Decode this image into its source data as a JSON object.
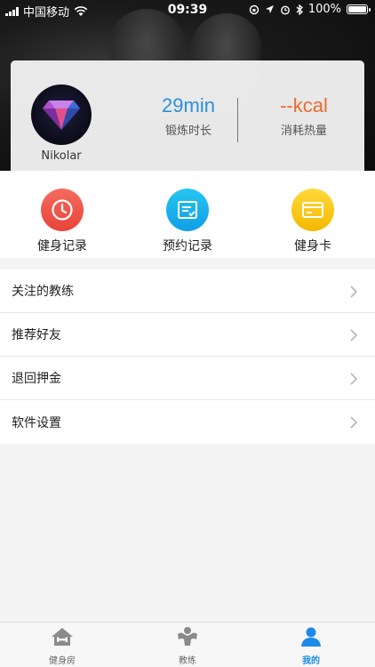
{
  "status_bar": {
    "carrier": "中国移动",
    "time": "09:39",
    "battery": "100%",
    "icons": [
      "signal-icon",
      "wifi-icon",
      "orientation-lock-icon",
      "location-icon",
      "alarm-icon",
      "bluetooth-icon",
      "battery-icon"
    ]
  },
  "profile": {
    "username": "Nikolar",
    "avatar_icon": "diamond-icon",
    "stats": [
      {
        "value": "29min",
        "label": "锻炼时长",
        "color": "#2b8fe0"
      },
      {
        "value": "--kcal",
        "label": "消耗热量",
        "color": "#e96c2b"
      }
    ]
  },
  "quick_actions": [
    {
      "label": "健身记录",
      "icon": "clock-icon",
      "color": "#ef5146"
    },
    {
      "label": "预约记录",
      "icon": "checklist-icon",
      "color": "#16abea"
    },
    {
      "label": "健身卡",
      "icon": "card-icon",
      "color": "#f8c612"
    }
  ],
  "menu": [
    {
      "label": "关注的教练"
    },
    {
      "label": "推荐好友"
    },
    {
      "label": "退回押金"
    },
    {
      "label": "软件设置"
    }
  ],
  "tabbar": {
    "tabs": [
      {
        "label": "健身房",
        "icon": "gym-house-icon",
        "active": false
      },
      {
        "label": "教练",
        "icon": "coach-icon",
        "active": false
      },
      {
        "label": "我的",
        "icon": "user-icon",
        "active": true
      }
    ],
    "active_color": "#1a8bea"
  }
}
